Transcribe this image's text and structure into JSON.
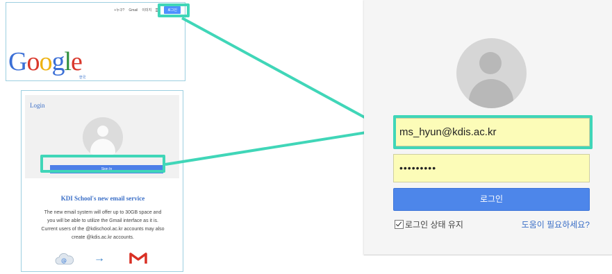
{
  "google": {
    "topbar_links": [
      "+누구?",
      "Gmail",
      "이미지"
    ],
    "login_button": "로그인",
    "logo_text": [
      "G",
      "o",
      "o",
      "g",
      "l",
      "e"
    ],
    "logo_sub": "한국"
  },
  "kdi": {
    "login_label": "Login",
    "sign_in": "Sign In",
    "heading": "KDI School's new email service",
    "desc_lines": [
      "The new email system will offer up to 30GB space and",
      "you will be able to utilize the Gmail interface as it is.",
      "Current users of the @kdischool.ac.kr accounts may also",
      "create @kdis.ac.kr accounts."
    ],
    "arrow": "→"
  },
  "login_form": {
    "email_value": "ms_hyun@kdis.ac.kr",
    "password_value": "•••••••••",
    "login_button": "로그인",
    "stay_signed_in": "로그인 상태 유지",
    "help_link": "도움이 필요하세요?"
  },
  "colors": {
    "highlight": "#40d6b8",
    "blue_button": "#4d86ea",
    "autofill": "#fcfcb8"
  }
}
